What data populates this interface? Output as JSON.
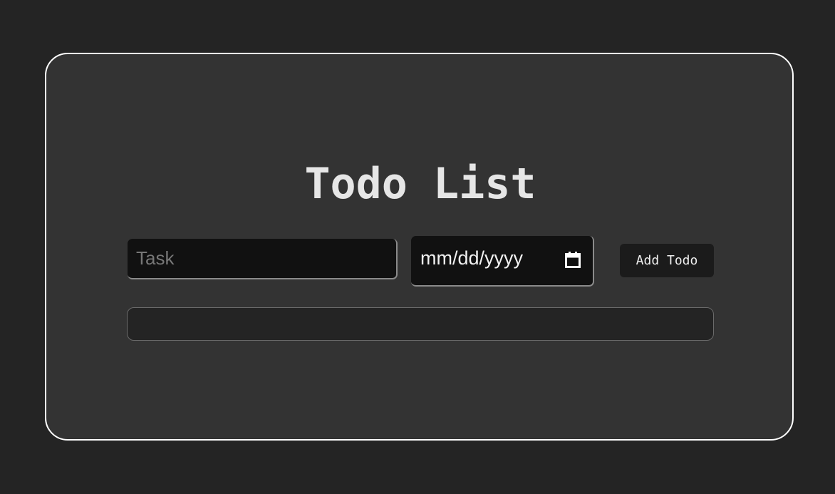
{
  "page": {
    "title": "Todo List"
  },
  "form": {
    "task_placeholder": "Task",
    "task_value": "",
    "date_placeholder": "mm/dd/yyyy",
    "date_icon": "calendar-icon",
    "add_button_label": "Add Todo"
  },
  "todos": [],
  "colors": {
    "page_background": "#242424",
    "card_background": "#333333",
    "card_border": "#ffffff",
    "input_background": "#111111",
    "button_background": "#1b1b1b",
    "text": "#e6e6e6"
  }
}
